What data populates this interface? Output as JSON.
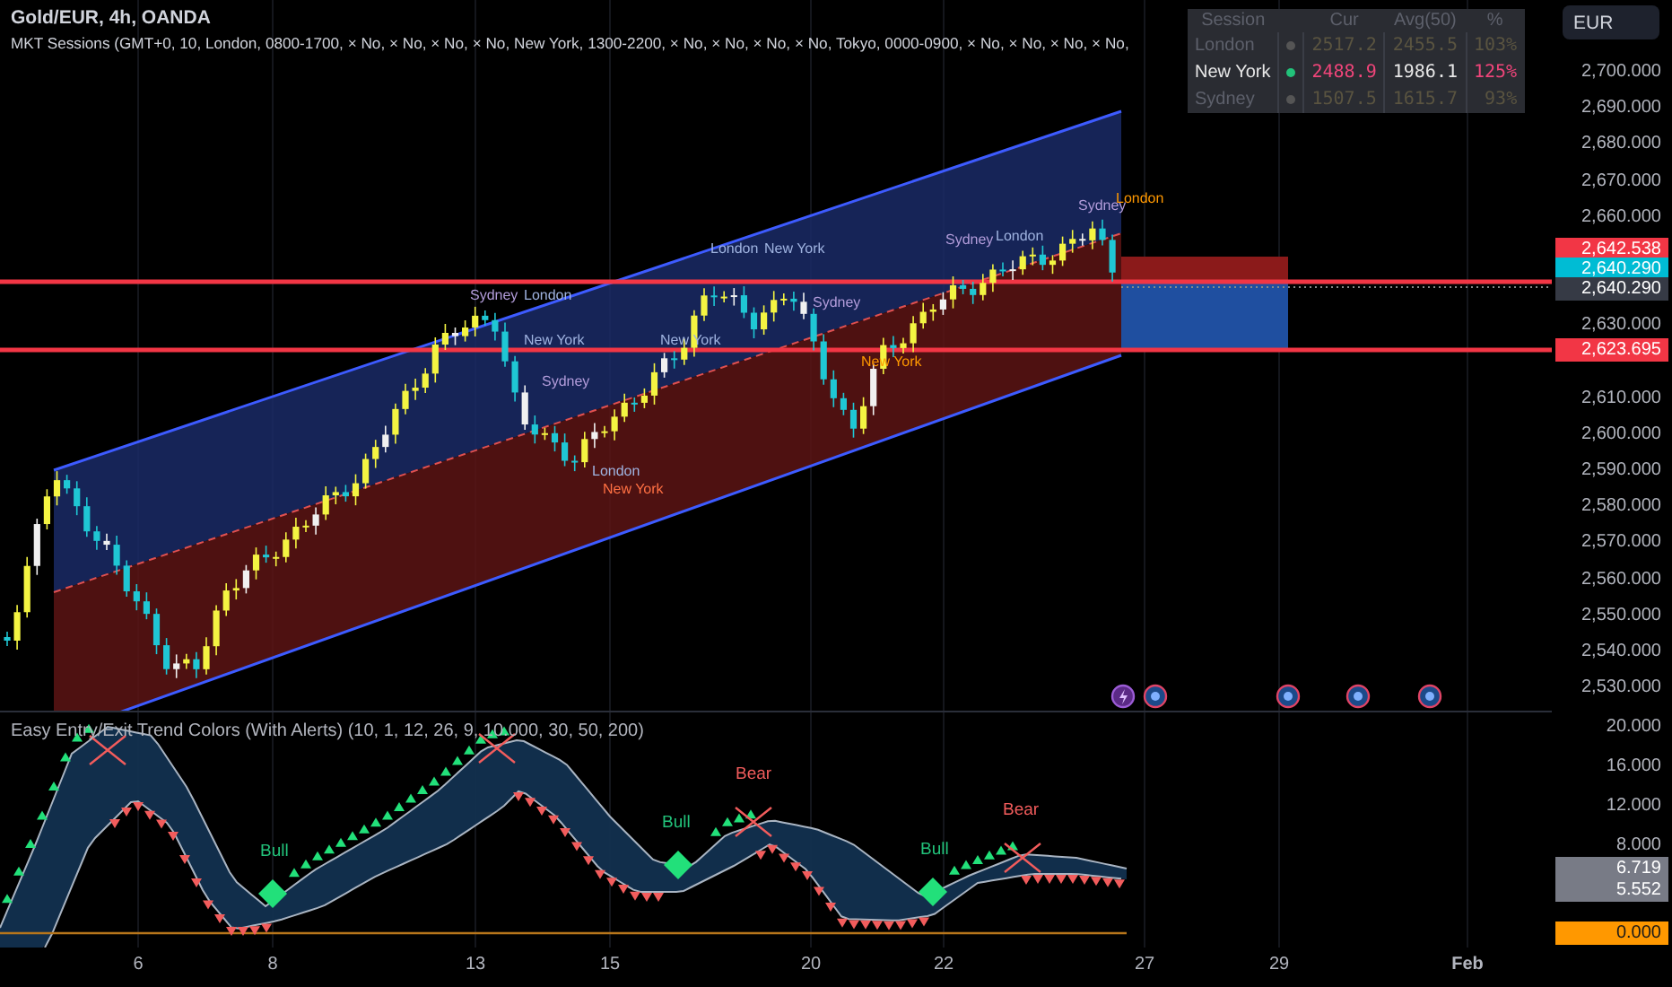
{
  "header": {
    "title": "Gold/EUR, 4h, OANDA",
    "indicator": "MKT Sessions (GMT+0, 10, London, 0800-1700, × No, × No, × No, × No, New York, 1300-2200, × No, × No, × No, × No, Tokyo, 0000-0900, × No, × No, × No, × No,"
  },
  "currency_button": "EUR",
  "session_table": {
    "columns": [
      "Session",
      "Cur",
      "Avg(50)",
      "%"
    ],
    "rows": [
      {
        "session": "London",
        "active": false,
        "cur": "2517.2",
        "avg": "2455.5",
        "pct": "103%"
      },
      {
        "session": "New York",
        "active": true,
        "cur": "2488.9",
        "avg": "1986.1",
        "pct": "125%"
      },
      {
        "session": "Sydney",
        "active": false,
        "cur": "1507.5",
        "avg": "1615.7",
        "pct": "93%"
      }
    ]
  },
  "price_axis": {
    "ticks": [
      "2,700.000",
      "2,690.000",
      "2,680.000",
      "2,670.000",
      "2,660.000",
      "2,630.000",
      "2,610.000",
      "2,600.000",
      "2,590.000",
      "2,580.000",
      "2,570.000",
      "2,560.000",
      "2,550.000",
      "2,540.000",
      "2,530.000"
    ],
    "badges": [
      {
        "text": "2,642.538",
        "color": "#f23645"
      },
      {
        "text": "2,640.290",
        "color": "#00bcd4"
      },
      {
        "text": "2,640.290",
        "color": "#363a45"
      },
      {
        "text": "2,623.695",
        "color": "#f23645"
      }
    ]
  },
  "chart": {
    "session_labels": [
      {
        "label": "Sydney",
        "color": "#b39ddb"
      },
      {
        "label": "London",
        "color": "#9fb3e0"
      },
      {
        "label": "New York",
        "color": "#9fb3e0"
      },
      {
        "label": "Sydney",
        "color": "#b39ddb"
      },
      {
        "label": "London",
        "color": "#9fb3e0"
      },
      {
        "label": "New York",
        "color": "#ff7043"
      },
      {
        "label": "New York",
        "color": "#9fb3e0"
      },
      {
        "label": "London",
        "color": "#9fb3e0"
      },
      {
        "label": "New York",
        "color": "#9fb3e0"
      },
      {
        "label": "Sydney",
        "color": "#b39ddb"
      },
      {
        "label": "New York",
        "color": "#ff9800"
      },
      {
        "label": "Sydney",
        "color": "#b39ddb"
      },
      {
        "label": "London",
        "color": "#9fb3e0"
      },
      {
        "label": "Sydney",
        "color": "#b39ddb"
      },
      {
        "label": "London",
        "color": "#ff9800"
      }
    ]
  },
  "indicator": {
    "title": "Easy Entry/Exit Trend Colors (With Alerts) (10, 1, 12, 26, 9, 10.000, 30, 50, 200)",
    "signals": [
      {
        "kind": "bull",
        "label": "Bull"
      },
      {
        "kind": "bull",
        "label": "Bull"
      },
      {
        "kind": "bear",
        "label": "Bear"
      },
      {
        "kind": "bull",
        "label": "Bull"
      },
      {
        "kind": "bear",
        "label": "Bear"
      }
    ],
    "ticks": [
      "20.000",
      "16.000",
      "12.000",
      "8.000"
    ],
    "badges": [
      {
        "text": "6.719",
        "color": "#787b86"
      },
      {
        "text": "5.552",
        "color": "#787b86"
      },
      {
        "text": "0.000",
        "color": "#ff9800"
      }
    ]
  },
  "time_axis": {
    "labels": [
      "6",
      "8",
      "13",
      "15",
      "20",
      "22",
      "27",
      "29",
      "Feb"
    ]
  }
}
